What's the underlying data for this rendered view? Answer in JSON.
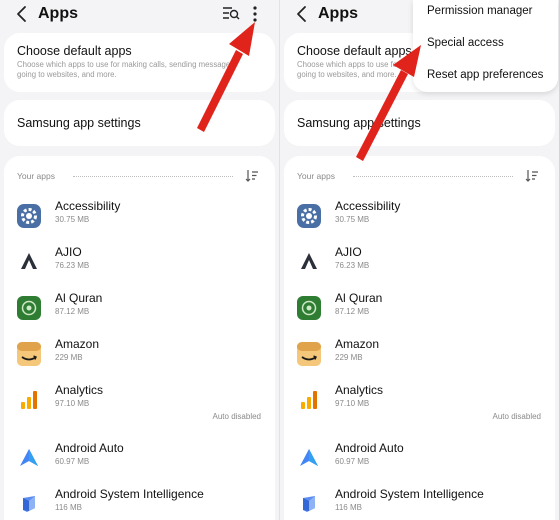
{
  "colors": {
    "background": "#f4f4f6",
    "card": "#ffffff",
    "annotation_arrow": "#e0241b",
    "secondary_text": "#8a8a8a"
  },
  "header": {
    "title": "Apps"
  },
  "default_apps": {
    "title": "Choose default apps",
    "description": "Choose which apps to use for making calls, sending messages, going to websites, and more."
  },
  "samsung_settings": {
    "title": "Samsung app settings"
  },
  "your_apps": {
    "label": "Your apps"
  },
  "apps": [
    {
      "name": "Accessibility",
      "size": "30.75 MB",
      "status": "",
      "icon": "gear-icon"
    },
    {
      "name": "AJIO",
      "size": "76.23 MB",
      "status": "",
      "icon": "ajio-logo-icon"
    },
    {
      "name": "Al Quran",
      "size": "87.12 MB",
      "status": "",
      "icon": "al-quran-icon"
    },
    {
      "name": "Amazon",
      "size": "229 MB",
      "status": "",
      "icon": "amazon-icon"
    },
    {
      "name": "Analytics",
      "size": "97.10 MB",
      "status": "Auto disabled",
      "icon": "analytics-icon"
    },
    {
      "name": "Android Auto",
      "size": "60.97 MB",
      "status": "",
      "icon": "android-auto-icon"
    },
    {
      "name": "Android System Intelligence",
      "size": "116 MB",
      "status": "",
      "icon": "system-intelligence-icon"
    }
  ],
  "overflow_menu": {
    "items": [
      "Permission manager",
      "Special access",
      "Reset app preferences"
    ]
  }
}
